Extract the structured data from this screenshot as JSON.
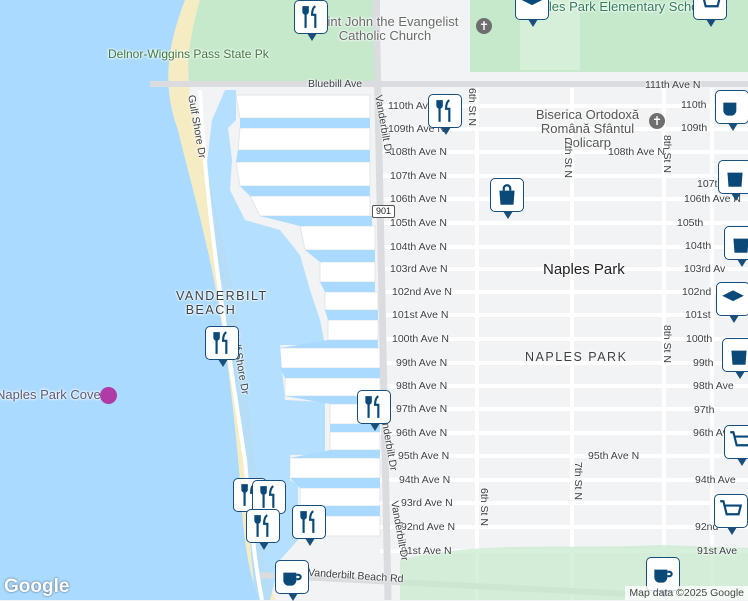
{
  "map": {
    "colors": {
      "water": "#aadaff",
      "land": "#f1f3f4",
      "park": "#c6e9cc",
      "beach": "#f6ecc4",
      "road": "#ffffff",
      "highway": "#dadce0",
      "pin": "#0b4a78"
    },
    "places": {
      "state_park": "Delnor-Wiggins Pass State Pk",
      "church": "Saint John the Evangelist Catholic Church",
      "orthodox": "Biserica Ortodoxă Română Sfântul Policarp",
      "school": "Naples Park Elementary School",
      "naples_park": "Naples Park",
      "naples_park_area": "NAPLES PARK",
      "vanderbilt_beach": "VANDERBILT BEACH",
      "cove": "Naples Park Cove"
    },
    "streets": {
      "bluebill": "Bluebill Ave",
      "ave111": "111th Ave N",
      "ave110": "110th Ave N",
      "ave109": "109th Ave N",
      "ave108": "108th Ave N",
      "ave107": "107th Ave N",
      "ave106": "106th Ave N",
      "ave105": "105th Ave N",
      "ave104": "104th Ave N",
      "ave103": "103rd Ave N",
      "ave102": "102nd Ave N",
      "ave101": "101st Ave N",
      "ave100": "100th Ave N",
      "ave99": "99th Ave N",
      "ave98": "98th Ave N",
      "ave97": "97th Ave N",
      "ave96": "96th Ave N",
      "ave95": "95th Ave N",
      "ave94": "94th Ave N",
      "ave93": "93rd Ave N",
      "ave92": "92nd Ave N",
      "ave91": "91st Ave N",
      "ave102_cut": "102nd",
      "ave101_cut": "101st",
      "ave100_cut": "100th",
      "ave99_cut": "99th",
      "ave98_cut": "98th Ave",
      "ave97_cut": "97th",
      "ave96_cut": "96th Ave",
      "ave94_cut": "94th Ave",
      "ave92_cut": "92nd",
      "ave91_cut": "91st Ave",
      "ave110_cut": "110th",
      "ave109_cut": "109th",
      "ave107_cut": "107th",
      "ave105_cut": "105th",
      "ave104_cut": "104th",
      "ave103_cut": "103rd Av",
      "st6": "6th St N",
      "st7": "7th St N",
      "st8": "8th St N",
      "vanderbilt_dr": "Vanderbilt Dr",
      "gulf_shore": "Gulf Shore Dr",
      "vanderbilt_beach_rd": "Vanderbilt Beach Rd",
      "route": "901"
    },
    "pin_icons": [
      "restaurant-icon",
      "shopping-bag-icon",
      "coffee-icon",
      "shopping-cart-icon",
      "school-icon"
    ],
    "attribution": "Map data ©2025 Google",
    "logo": "Google"
  }
}
